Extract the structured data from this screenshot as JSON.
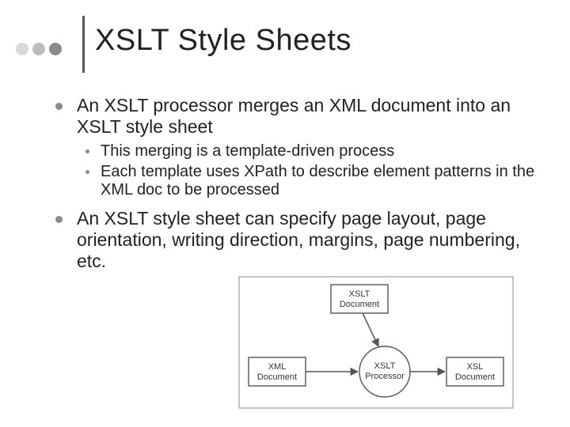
{
  "title": "XSLT Style Sheets",
  "bullets": {
    "b1": "An XSLT processor merges an XML document into an XSLT style sheet",
    "b1_sub1": "This merging is a template-driven process",
    "b1_sub2": "Each template uses XPath to describe element patterns in the XML doc to be processed",
    "b2": "An XSLT style sheet can specify page layout, page orientation, writing direction, margins, page numbering, etc."
  },
  "diagram": {
    "xslt_doc_l1": "XSLT",
    "xslt_doc_l2": "Document",
    "xml_doc_l1": "XML",
    "xml_doc_l2": "Document",
    "processor_l1": "XSLT",
    "processor_l2": "Processor",
    "xsl_doc_l1": "XSL",
    "xsl_doc_l2": "Document"
  }
}
